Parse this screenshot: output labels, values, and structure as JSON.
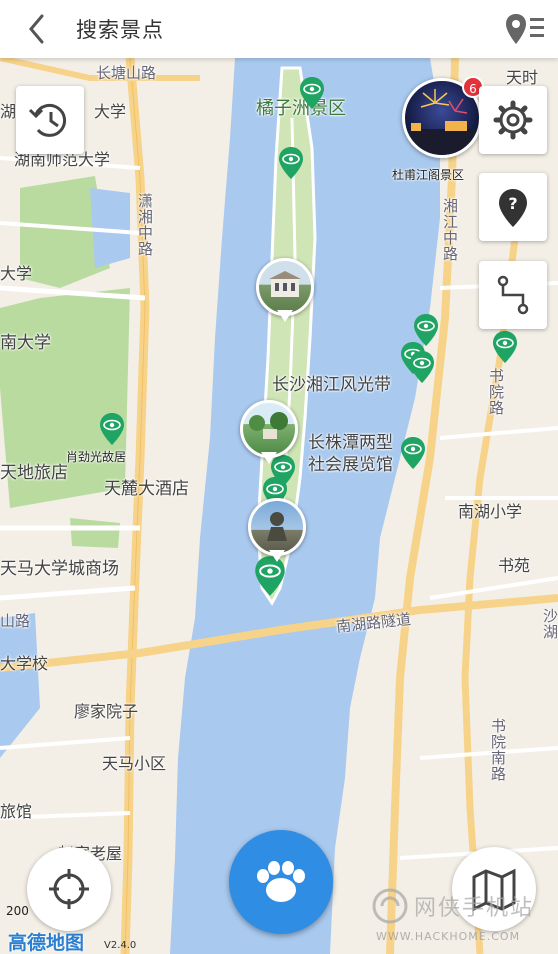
{
  "header": {
    "title": "搜索景点"
  },
  "colors": {
    "water": "#a9c9ef",
    "road": "#f7d38a",
    "park": "#b9dba0",
    "pin": "#1fa463",
    "accent": "#2f8de4",
    "badge": "#e2333b"
  },
  "map": {
    "labels": {
      "changtang_rd": "长塘山路",
      "univ_a": "湖",
      "univ_a2": "大学",
      "hunan_normal": "湖南师范大学",
      "daxue": "大学",
      "nan_daxue": "南大学",
      "juzizhou": "橘子洲景区",
      "dufu": "杜甫江阁景区",
      "lushan_rd": "潇湘中路",
      "xiangjiang_rd": "湘江中路",
      "cs_scenic": "长沙湘江风光带",
      "cz_exhibit1": "长株潭两型",
      "cz_exhibit2": "社会展览馆",
      "xiaojinguang": "肖劲光故居",
      "tiandi": "天地旅店",
      "tianlu_hotel": "天麓大酒店",
      "tianma_mall": "天马大学城商场",
      "nanhu_school": "南湖小学",
      "shuyuan": "书苑",
      "shuyuan_rd": "书院路",
      "nanhu_tunnel": "南湖路隧道",
      "left_shan": "山路",
      "xuexiao": "大学校",
      "liaojia": "廖家院子",
      "tianma_xq": "天马小区",
      "lvguan": "旅馆",
      "zhaojia": "赵家老屋",
      "shuyuan_rd2": "书院南路",
      "shapo": "沙湖",
      "tianshi": "天时"
    },
    "badge_count": "6",
    "scale": "200",
    "logo": "高德地图",
    "version": "V2.4.0",
    "watermark": "网侠手机站",
    "watermark_url": "WWW.HACKHOME.COM"
  },
  "icons": [
    "back-arrow-icon",
    "location-list-icon",
    "history-icon",
    "settings-gear-icon",
    "question-pin-icon",
    "route-icon",
    "crosshair-icon",
    "paw-icon",
    "map-book-icon",
    "eye-pin-icon"
  ]
}
